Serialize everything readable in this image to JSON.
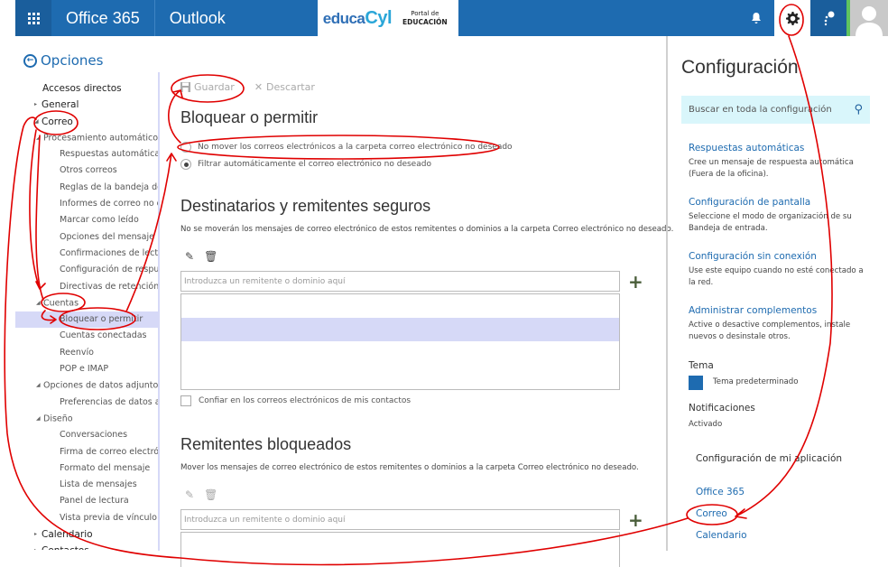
{
  "topbar": {
    "brand": "Office 365",
    "app": "Outlook",
    "logo_main": "educa",
    "logo_accent": "Cyl",
    "logo_sub_1": "Portal de",
    "logo_sub_2": "EDUCACIÓN",
    "icons": [
      "app-launcher-icon",
      "bell-icon",
      "gear-icon",
      "help-icon",
      "avatar-icon"
    ]
  },
  "nav": {
    "back_label": "Opciones",
    "items": [
      {
        "label": "Accesos directos",
        "level": 0,
        "arrow": ""
      },
      {
        "label": "General",
        "level": 0,
        "arrow": "▸"
      },
      {
        "label": "Correo",
        "level": 0,
        "arrow": "◢"
      },
      {
        "label": "Procesamiento automático",
        "level": 1,
        "arrow": "◢"
      },
      {
        "label": "Respuestas automáticas",
        "level": 2,
        "arrow": ""
      },
      {
        "label": "Otros correos",
        "level": 2,
        "arrow": ""
      },
      {
        "label": "Reglas de la bandeja de entrada",
        "level": 2,
        "arrow": ""
      },
      {
        "label": "Informes de correo no deseado",
        "level": 2,
        "arrow": ""
      },
      {
        "label": "Marcar como leído",
        "level": 2,
        "arrow": ""
      },
      {
        "label": "Opciones del mensaje",
        "level": 2,
        "arrow": ""
      },
      {
        "label": "Confirmaciones de lectura",
        "level": 2,
        "arrow": ""
      },
      {
        "label": "Configuración de respuesta",
        "level": 2,
        "arrow": ""
      },
      {
        "label": "Directivas de retención",
        "level": 2,
        "arrow": ""
      },
      {
        "label": "Cuentas",
        "level": 1,
        "arrow": "◢"
      },
      {
        "label": "Bloquear o permitir",
        "level": 2,
        "arrow": "",
        "selected": true
      },
      {
        "label": "Cuentas conectadas",
        "level": 2,
        "arrow": ""
      },
      {
        "label": "Reenvío",
        "level": 2,
        "arrow": ""
      },
      {
        "label": "POP e IMAP",
        "level": 2,
        "arrow": ""
      },
      {
        "label": "Opciones de datos adjuntos",
        "level": 1,
        "arrow": "◢"
      },
      {
        "label": "Preferencias de datos adjuntos",
        "level": 2,
        "arrow": ""
      },
      {
        "label": "Diseño",
        "level": 1,
        "arrow": "◢"
      },
      {
        "label": "Conversaciones",
        "level": 2,
        "arrow": ""
      },
      {
        "label": "Firma de correo electrónico",
        "level": 2,
        "arrow": ""
      },
      {
        "label": "Formato del mensaje",
        "level": 2,
        "arrow": ""
      },
      {
        "label": "Lista de mensajes",
        "level": 2,
        "arrow": ""
      },
      {
        "label": "Panel de lectura",
        "level": 2,
        "arrow": ""
      },
      {
        "label": "Vista previa de vínculo",
        "level": 2,
        "arrow": ""
      },
      {
        "label": "Calendario",
        "level": 0,
        "arrow": "▸"
      },
      {
        "label": "Contactos",
        "level": 0,
        "arrow": "▸"
      }
    ]
  },
  "main": {
    "save_label": "Guardar",
    "discard_label": "Descartar",
    "title": "Bloquear o permitir",
    "radio_options": [
      {
        "label": "No mover los correos electrónicos a la carpeta correo electrónico no deseado",
        "checked": false
      },
      {
        "label": "Filtrar automáticamente el correo electrónico no deseado",
        "checked": true
      }
    ],
    "safe": {
      "title": "Destinatarios y remitentes seguros",
      "description": "No se moverán los mensajes de correo electrónico de estos remitentes o dominios a la carpeta Correo electrónico no deseado.",
      "placeholder": "Introduzca un remitente o dominio aquí",
      "add_label": "+",
      "entries": [],
      "trust_contacts_label": "Confiar en los correos electrónicos de mis contactos",
      "trust_contacts_checked": false
    },
    "blocked": {
      "title": "Remitentes bloqueados",
      "description": "Mover los mensajes de correo electrónico de estos remitentes o dominios a la carpeta Correo electrónico no deseado.",
      "placeholder": "Introduzca un remitente o dominio aquí",
      "add_label": "+",
      "entries": []
    }
  },
  "settings": {
    "title": "Configuración",
    "search_placeholder": "Buscar en toda la configuración",
    "links": [
      {
        "title": "Respuestas automáticas",
        "desc": "Cree un mensaje de respuesta automática (Fuera de la oficina)."
      },
      {
        "title": "Configuración de pantalla",
        "desc": "Seleccione el modo de organización de su Bandeja de entrada."
      },
      {
        "title": "Configuración sin conexión",
        "desc": "Use este equipo cuando no esté conectado a la red."
      },
      {
        "title": "Administrar complementos",
        "desc": "Active o desactive complementos, instale nuevos o desinstale otros."
      }
    ],
    "theme_label": "Tema",
    "theme_value": "Tema predeterminado",
    "theme_color": "#1e6bb0",
    "notifications_label": "Notificaciones",
    "notifications_value": "Activado",
    "app_settings_title": "Configuración de mi aplicación",
    "app_links": [
      "Office 365",
      "Correo",
      "Calendario"
    ]
  },
  "colors": {
    "brand_blue": "#1e6bb0",
    "selection": "#d6d9f7",
    "search_bg": "#d9f6fb",
    "annotation_red": "#e00000"
  }
}
